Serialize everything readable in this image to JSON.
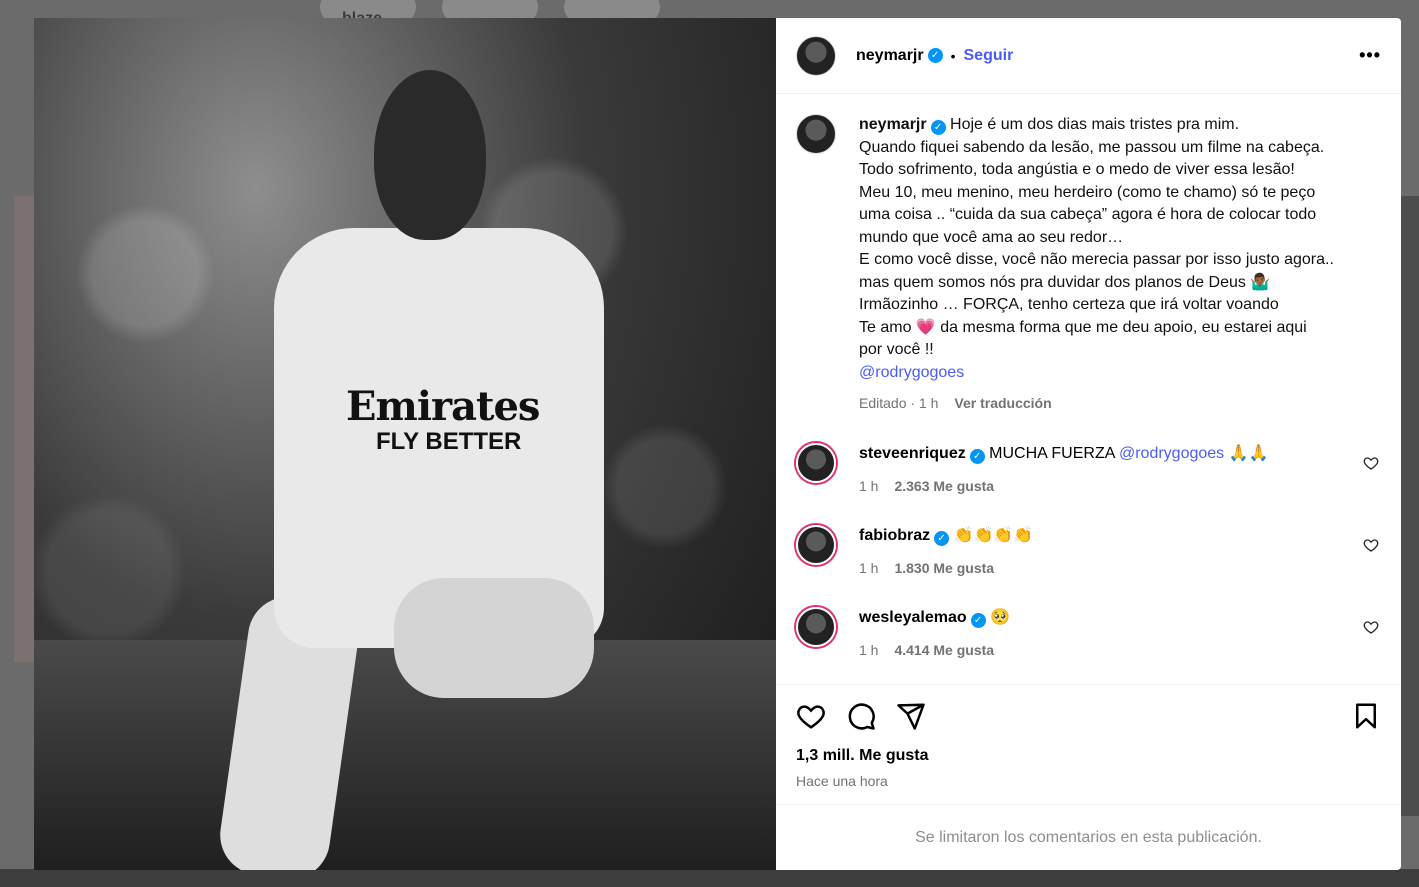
{
  "background": {
    "top_badge": "blaze"
  },
  "post": {
    "image_alt": "",
    "shirt_sponsor": "Emirates",
    "shirt_sponsor_sub": "FLY BETTER"
  },
  "header": {
    "username": "neymarjr",
    "separator": "•",
    "follow_label": "Seguir",
    "more_label": "•••"
  },
  "caption": {
    "username": "neymarjr",
    "lines": [
      "Hoje é um dos dias mais tristes pra mim.",
      "Quando fiquei sabendo da lesão, me passou um filme na cabeça.",
      "Todo sofrimento, toda angústia e o medo de viver essa lesão!",
      "Meu 10, meu menino, meu herdeiro (como te chamo) só te peço",
      "uma coisa .. “cuida da sua cabeça” agora é hora de colocar todo",
      "mundo que você ama ao seu redor…",
      "E como você disse, você não merecia passar por isso justo agora..",
      "mas quem somos nós pra duvidar dos planos de Deus 🤷🏾‍♂️",
      "Irmãozinho … FORÇA, tenho certeza que irá voltar voando",
      "Te amo 💗 da mesma forma que me deu apoio, eu estarei aqui",
      "por você !!"
    ],
    "mention": "@rodrygogoes",
    "edited": "Editado · 1 h",
    "translate": "Ver traducción"
  },
  "comments": [
    {
      "username": "steveenriquez",
      "text": "MUCHA FUERZA ",
      "mention": "@rodrygogoes",
      "suffix": " 🙏🙏",
      "time": "1 h",
      "likes": "2.363 Me gusta"
    },
    {
      "username": "fabiobraz",
      "text": "👏👏👏👏",
      "mention": "",
      "suffix": "",
      "time": "1 h",
      "likes": "1.830 Me gusta"
    },
    {
      "username": "wesleyalemao",
      "text": "🥺",
      "mention": "",
      "suffix": "",
      "time": "1 h",
      "likes": "4.414 Me gusta"
    }
  ],
  "actions": {
    "likes_total": "1,3 mill. Me gusta",
    "time_ago": "Hace una hora"
  },
  "footer": {
    "limited_text": "Se limitaron los comentarios en esta publicación."
  },
  "colors": {
    "link": "#4a5df9",
    "verified": "#0095f6",
    "muted": "#737373"
  }
}
